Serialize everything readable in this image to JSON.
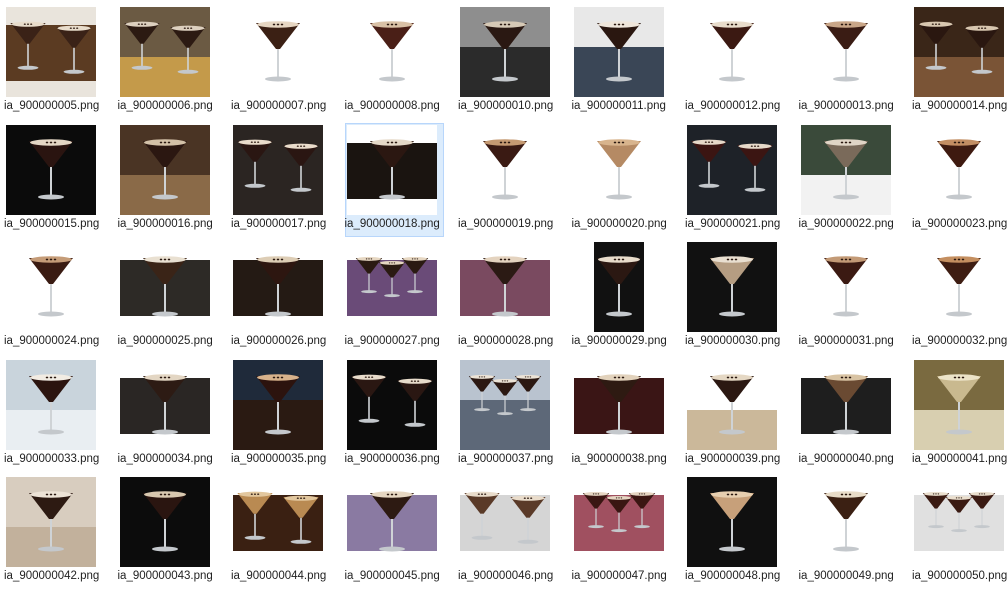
{
  "files": [
    {
      "name": "ia_900000005.png",
      "scene": "dark",
      "glasses": 2,
      "bg": "#e9e4dc",
      "table": "#5b3b22",
      "drink": "#3a2217",
      "foam": "#e8dccb"
    },
    {
      "name": "ia_900000006.png",
      "scene": "tray",
      "glasses": 2,
      "bg": "#6b5a43",
      "table": "#c49a4a",
      "drink": "#2c1a12",
      "foam": "#ddd0bf"
    },
    {
      "name": "ia_900000007.png",
      "scene": "white",
      "glasses": 1,
      "bg": "#ffffff",
      "table": "#ffffff",
      "drink": "#3b2014",
      "foam": "#e6d6c2"
    },
    {
      "name": "ia_900000008.png",
      "scene": "white",
      "glasses": 1,
      "bg": "#ffffff",
      "table": "#ffffff",
      "drink": "#4a1f17",
      "foam": "#d9c1a6"
    },
    {
      "name": "ia_900000010.png",
      "scene": "grey",
      "glasses": 1,
      "bg": "#8e8e8e",
      "table": "#2b2b2b",
      "drink": "#2a1812",
      "foam": "#d6c9b6"
    },
    {
      "name": "ia_900000011.png",
      "scene": "slate",
      "glasses": 1,
      "bg": "#e8e8e8",
      "table": "#3a4656",
      "drink": "#2a1710",
      "foam": "#efe6db"
    },
    {
      "name": "ia_900000012.png",
      "scene": "white",
      "glasses": 1,
      "bg": "#ffffff",
      "table": "#ffffff",
      "drink": "#3b1912",
      "foam": "#e8dccb"
    },
    {
      "name": "ia_900000013.png",
      "scene": "white",
      "glasses": 1,
      "bg": "#ffffff",
      "table": "#ffffff",
      "drink": "#3a1c14",
      "foam": "#c9a688"
    },
    {
      "name": "ia_900000014.png",
      "scene": "wood",
      "glasses": 2,
      "bg": "#3a2618",
      "table": "#7a5436",
      "drink": "#2a1710",
      "foam": "#d8c7b0"
    },
    {
      "name": "ia_900000015.png",
      "scene": "black",
      "glasses": 1,
      "bg": "#0b0b0b",
      "table": "#0b0b0b",
      "drink": "#2a1410",
      "foam": "#e4d7c5"
    },
    {
      "name": "ia_900000016.png",
      "scene": "bar",
      "glasses": 1,
      "bg": "#4a3424",
      "table": "#8a6a48",
      "drink": "#2b1711",
      "foam": "#d3c1a8"
    },
    {
      "name": "ia_900000017.png",
      "scene": "black",
      "glasses": 2,
      "bg": "#161412",
      "table": "#2b2522",
      "drink": "#2a1612",
      "foam": "#e9dccb"
    },
    {
      "name": "ia_900000018.png",
      "scene": "band",
      "glasses": 1,
      "bg": "#ffffff",
      "table": "#1a1410",
      "drink": "#2b1711",
      "foam": "#e5d9c8"
    },
    {
      "name": "ia_900000019.png",
      "scene": "white",
      "glasses": 1,
      "bg": "#ffffff",
      "table": "#ffffff",
      "drink": "#3a1a13",
      "foam": "#c59a72"
    },
    {
      "name": "ia_900000020.png",
      "scene": "white",
      "glasses": 1,
      "bg": "#ffffff",
      "table": "#ffffff",
      "drink": "#b58a64",
      "foam": "#d8b48d"
    },
    {
      "name": "ia_900000021.png",
      "scene": "black",
      "glasses": 2,
      "bg": "#121418",
      "table": "#1e2228",
      "drink": "#3b1512",
      "foam": "#e6d9c9"
    },
    {
      "name": "ia_900000022.png",
      "scene": "cloth",
      "glasses": 1,
      "bg": "#3a4a3a",
      "table": "#f2f2f2",
      "drink": "#7a6a5a",
      "foam": "#e0d5c6"
    },
    {
      "name": "ia_900000023.png",
      "scene": "white",
      "glasses": 1,
      "bg": "#ffffff",
      "table": "#ffffff",
      "drink": "#3e1a10",
      "foam": "#c38e63"
    },
    {
      "name": "ia_900000024.png",
      "scene": "white",
      "glasses": 1,
      "bg": "#ffffff",
      "table": "#ffffff",
      "drink": "#3a1b12",
      "foam": "#c59c78"
    },
    {
      "name": "ia_900000025.png",
      "scene": "dark",
      "glasses": 1,
      "bg": "#ffffff",
      "table": "#2d2a26",
      "drink": "#3a2417",
      "foam": "#e9e0d1"
    },
    {
      "name": "ia_900000026.png",
      "scene": "dark",
      "glasses": 1,
      "bg": "#ffffff",
      "table": "#241a14",
      "drink": "#2d1610",
      "foam": "#ddcdb5"
    },
    {
      "name": "ia_900000027.png",
      "scene": "purple",
      "glasses": 3,
      "bg": "#ffffff",
      "table": "#6a4b78",
      "drink": "#2a1a12",
      "foam": "#e6d7c2"
    },
    {
      "name": "ia_900000028.png",
      "scene": "purple",
      "glasses": 1,
      "bg": "#ffffff",
      "table": "#7a4a60",
      "drink": "#2b1a14",
      "foam": "#e4d3bf"
    },
    {
      "name": "ia_900000029.png",
      "scene": "poster",
      "glasses": 1,
      "bg": "#ffffff",
      "table": "#111111",
      "drink": "#2b1812",
      "foam": "#e8dccb"
    },
    {
      "name": "ia_900000030.png",
      "scene": "black",
      "glasses": 1,
      "bg": "#ffffff",
      "table": "#111111",
      "drink": "#b59d82",
      "foam": "#e9dfd0"
    },
    {
      "name": "ia_900000031.png",
      "scene": "white",
      "glasses": 1,
      "bg": "#ffffff",
      "table": "#ffffff",
      "drink": "#3b1a12",
      "foam": "#c39a76"
    },
    {
      "name": "ia_900000032.png",
      "scene": "white",
      "glasses": 1,
      "bg": "#ffffff",
      "table": "#ffffff",
      "drink": "#3e1d12",
      "foam": "#c48f60"
    },
    {
      "name": "ia_900000033.png",
      "scene": "coupe",
      "glasses": 1,
      "bg": "#c9d4dc",
      "table": "#e9eef2",
      "drink": "#2b140f",
      "foam": "#f2ece3"
    },
    {
      "name": "ia_900000034.png",
      "scene": "band",
      "glasses": 1,
      "bg": "#ffffff",
      "table": "#2a2624",
      "drink": "#2d1b14",
      "foam": "#e3d6c3"
    },
    {
      "name": "ia_900000035.png",
      "scene": "hand",
      "glasses": 1,
      "bg": "#1f2a3a",
      "table": "#2a1a12",
      "drink": "#2c130e",
      "foam": "#d7b28b"
    },
    {
      "name": "ia_900000036.png",
      "scene": "black",
      "glasses": 2,
      "bg": "#ffffff",
      "table": "#0b0b0b",
      "drink": "#2a1712",
      "foam": "#e8dccb"
    },
    {
      "name": "ia_900000037.png",
      "scene": "slate",
      "glasses": 3,
      "bg": "#b9c3cf",
      "table": "#5d6878",
      "drink": "#2b1812",
      "foam": "#ece3d6"
    },
    {
      "name": "ia_900000038.png",
      "scene": "darkred",
      "glasses": 1,
      "bg": "#ffffff",
      "table": "#3a1515",
      "drink": "#2e1a12",
      "foam": "#e2d2bc"
    },
    {
      "name": "ia_900000039.png",
      "scene": "wood",
      "glasses": 1,
      "bg": "#ffffff",
      "table": "#cbb89a",
      "drink": "#2b1812",
      "foam": "#e5d8c4"
    },
    {
      "name": "ia_900000040.png",
      "scene": "dark",
      "glasses": 1,
      "bg": "#ffffff",
      "table": "#1e1e1e",
      "drink": "#6a4a32",
      "foam": "#d8c3a3"
    },
    {
      "name": "ia_900000041.png",
      "scene": "coupe",
      "glasses": 1,
      "bg": "#7a6a40",
      "table": "#d8cfb0",
      "drink": "#c9b98f",
      "foam": "#ece3c8"
    },
    {
      "name": "ia_900000042.png",
      "scene": "coupe",
      "glasses": 1,
      "bg": "#d8cdbf",
      "table": "#c2b19c",
      "drink": "#2d1a12",
      "foam": "#ede3d6"
    },
    {
      "name": "ia_900000043.png",
      "scene": "black",
      "glasses": 1,
      "bg": "#ffffff",
      "table": "#0c0c0c",
      "drink": "#2a1510",
      "foam": "#d8c8b0"
    },
    {
      "name": "ia_900000044.png",
      "scene": "candle",
      "glasses": 2,
      "bg": "#ffffff",
      "table": "#3a2012",
      "drink": "#b98a52",
      "foam": "#e2c79e"
    },
    {
      "name": "ia_900000045.png",
      "scene": "lavender",
      "glasses": 1,
      "bg": "#ffffff",
      "table": "#8a7aa2",
      "drink": "#2d1a12",
      "foam": "#e6d7c2"
    },
    {
      "name": "ia_900000046.png",
      "scene": "lightgrey",
      "glasses": 2,
      "bg": "#ffffff",
      "table": "#d5d5d5",
      "drink": "#5a3a28",
      "foam": "#e9dccb"
    },
    {
      "name": "ia_900000047.png",
      "scene": "pink",
      "glasses": 3,
      "bg": "#ffffff",
      "table": "#a05060",
      "drink": "#3a1612",
      "foam": "#e6d6c3"
    },
    {
      "name": "ia_900000048.png",
      "scene": "black",
      "glasses": 1,
      "bg": "#ffffff",
      "table": "#101010",
      "drink": "#c7a07a",
      "foam": "#e7cfb0"
    },
    {
      "name": "ia_900000049.png",
      "scene": "white",
      "glasses": 1,
      "bg": "#ffffff",
      "table": "#ffffff",
      "drink": "#3b2013",
      "foam": "#e8dcc8"
    },
    {
      "name": "ia_900000050.png",
      "scene": "lightgrey",
      "glasses": 3,
      "bg": "#ffffff",
      "table": "#e0e0e0",
      "drink": "#3a1a12",
      "foam": "#eadfce"
    }
  ],
  "selected_index": 12
}
